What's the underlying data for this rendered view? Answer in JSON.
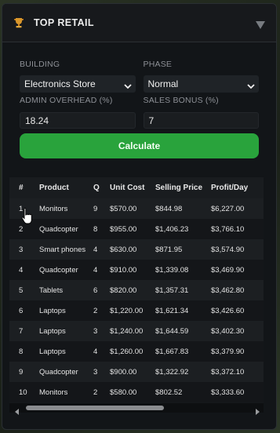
{
  "header": {
    "title": "TOP RETAIL",
    "icon": "trophy-icon"
  },
  "form": {
    "building": {
      "label": "BUILDING",
      "value": "Electronics Store"
    },
    "phase": {
      "label": "PHASE",
      "value": "Normal"
    },
    "admin_overhead": {
      "label": "ADMIN OVERHEAD (%)",
      "value": "18.24"
    },
    "sales_bonus": {
      "label": "SALES BONUS (%)",
      "value": "7"
    },
    "calculate_label": "Calculate"
  },
  "table": {
    "columns": [
      "#",
      "Product",
      "Q",
      "Unit Cost",
      "Selling Price",
      "Profit/Day"
    ],
    "rows": [
      [
        "1",
        "Monitors",
        "9",
        "$570.00",
        "$844.98",
        "$6,227.00"
      ],
      [
        "2",
        "Quadcopter",
        "8",
        "$955.00",
        "$1,406.23",
        "$3,766.10"
      ],
      [
        "3",
        "Smart phones",
        "4",
        "$630.00",
        "$871.95",
        "$3,574.90"
      ],
      [
        "4",
        "Quadcopter",
        "4",
        "$910.00",
        "$1,339.08",
        "$3,469.90"
      ],
      [
        "5",
        "Tablets",
        "6",
        "$820.00",
        "$1,357.31",
        "$3,462.80"
      ],
      [
        "6",
        "Laptops",
        "2",
        "$1,220.00",
        "$1,621.34",
        "$3,426.60"
      ],
      [
        "7",
        "Laptops",
        "3",
        "$1,240.00",
        "$1,644.59",
        "$3,402.30"
      ],
      [
        "8",
        "Laptops",
        "4",
        "$1,260.00",
        "$1,667.83",
        "$3,379.90"
      ],
      [
        "9",
        "Quadcopter",
        "3",
        "$900.00",
        "$1,322.92",
        "$3,372.10"
      ],
      [
        "10",
        "Monitors",
        "2",
        "$580.00",
        "$802.52",
        "$3,333.60"
      ]
    ]
  },
  "colors": {
    "accent": "#29a33c",
    "panel": "#121518",
    "header": "#17191c"
  }
}
